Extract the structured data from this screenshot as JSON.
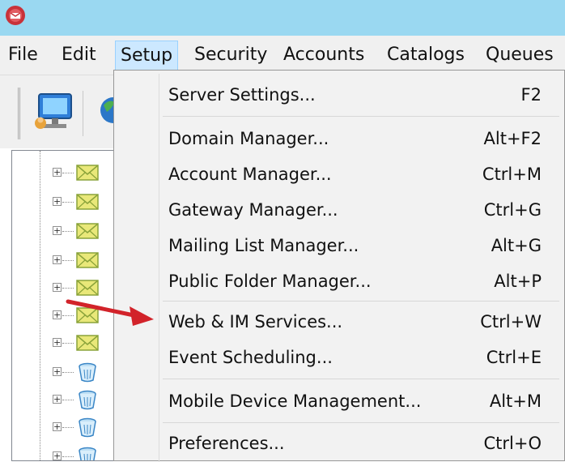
{
  "menubar": {
    "items": [
      {
        "label": "File"
      },
      {
        "label": "Edit"
      },
      {
        "label": "Setup"
      },
      {
        "label": "Security"
      },
      {
        "label": "Accounts"
      },
      {
        "label": "Catalogs"
      },
      {
        "label": "Queues"
      }
    ],
    "active": "Setup"
  },
  "setup_menu": {
    "items": [
      {
        "label": "Server Settings...",
        "shortcut": "F2"
      },
      {
        "label": "Domain Manager...",
        "shortcut": "Alt+F2"
      },
      {
        "label": "Account Manager...",
        "shortcut": "Ctrl+M"
      },
      {
        "label": "Gateway Manager...",
        "shortcut": "Ctrl+G"
      },
      {
        "label": "Mailing List Manager...",
        "shortcut": "Alt+G"
      },
      {
        "label": "Public Folder Manager...",
        "shortcut": "Alt+P"
      },
      {
        "label": "Web & IM Services...",
        "shortcut": "Ctrl+W"
      },
      {
        "label": "Event Scheduling...",
        "shortcut": "Ctrl+E"
      },
      {
        "label": "Mobile Device Management...",
        "shortcut": "Alt+M"
      },
      {
        "label": "Preferences...",
        "shortcut": "Ctrl+O"
      }
    ]
  },
  "tree": {
    "expander_glyph": "+",
    "items": [
      {
        "icon": "envelope-icon"
      },
      {
        "icon": "envelope-icon"
      },
      {
        "icon": "envelope-icon"
      },
      {
        "icon": "envelope-icon"
      },
      {
        "icon": "envelope-icon"
      },
      {
        "icon": "envelope-icon"
      },
      {
        "icon": "envelope-icon"
      },
      {
        "icon": "trash-icon"
      },
      {
        "icon": "trash-icon"
      },
      {
        "icon": "trash-icon"
      },
      {
        "icon": "trash-icon"
      }
    ]
  },
  "colors": {
    "titlebar": "#9ad8f1",
    "menu_highlight": "#cce8ff",
    "annotation_arrow": "#d2232a"
  }
}
